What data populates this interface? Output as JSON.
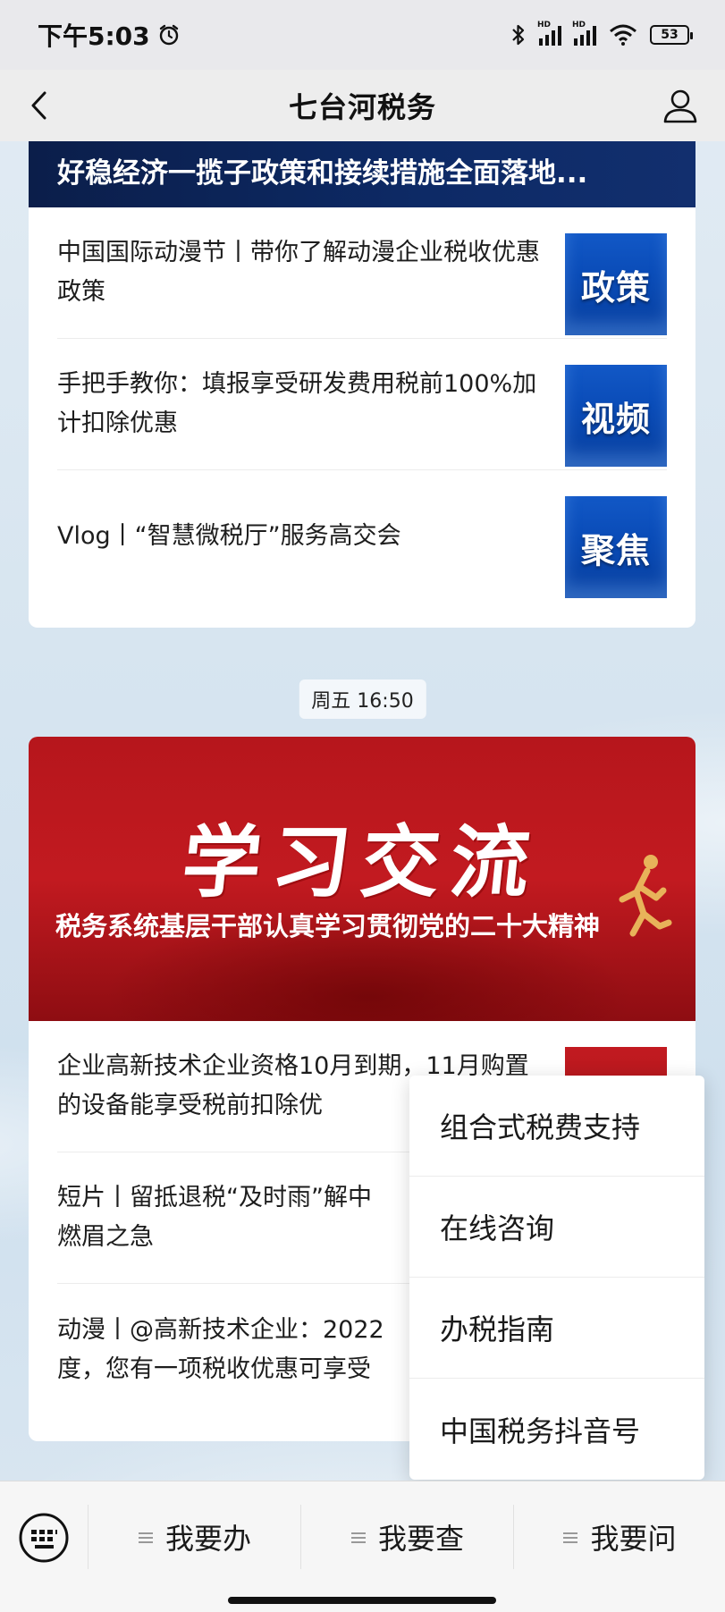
{
  "status_bar": {
    "time": "下午5:03",
    "alarm_icon": "alarm-clock-icon",
    "bluetooth_icon": "bluetooth-icon",
    "signal_label_1": "HD",
    "signal_label_2": "HD",
    "wifi_icon": "wifi-icon",
    "battery": "53"
  },
  "nav": {
    "title": "七台河税务",
    "back_icon": "back-arrow-icon",
    "profile_icon": "user-profile-icon"
  },
  "card1": {
    "header": "好稳经济一揽子政策和接续措施全面落地...",
    "articles": [
      {
        "title": "中国国际动漫节丨带你了解动漫企业税收优惠政策",
        "thumb_label": "政策"
      },
      {
        "title": "手把手教你：填报享受研发费用税前100%加计扣除优惠",
        "thumb_label": "视频"
      },
      {
        "title": "Vlog丨“智慧微税厅”服务高交会",
        "thumb_label": "聚焦"
      }
    ]
  },
  "timestamp": "周五 16:50",
  "card2": {
    "banner_calligraphy": "学习交流",
    "banner_title": "税务系统基层干部认真学习贯彻党的二十大精神",
    "articles": [
      {
        "title": "企业高新技术企业资格10月到期，11月购置的设备能享受税前扣除优"
      },
      {
        "title": "短片丨留抵退税“及时雨”解中"
      },
      {
        "title_line1": "动漫丨@高新技术企业：2022",
        "title_line2": "度，您有一项税收优惠可享受"
      }
    ],
    "article_2_line2": "燃眉之急"
  },
  "popup_menu": {
    "items": [
      "组合式税费支持",
      "在线咨询",
      "办税指南",
      "中国税务抖音号"
    ]
  },
  "bottom_menu": {
    "keyboard_icon": "keyboard-icon",
    "tabs": [
      "我要办",
      "我要查",
      "我要问"
    ]
  },
  "colors": {
    "card1_header_bg": "#0b1e4a",
    "thumb_blue": "#0a4cb8",
    "banner_red": "#c21a20"
  }
}
